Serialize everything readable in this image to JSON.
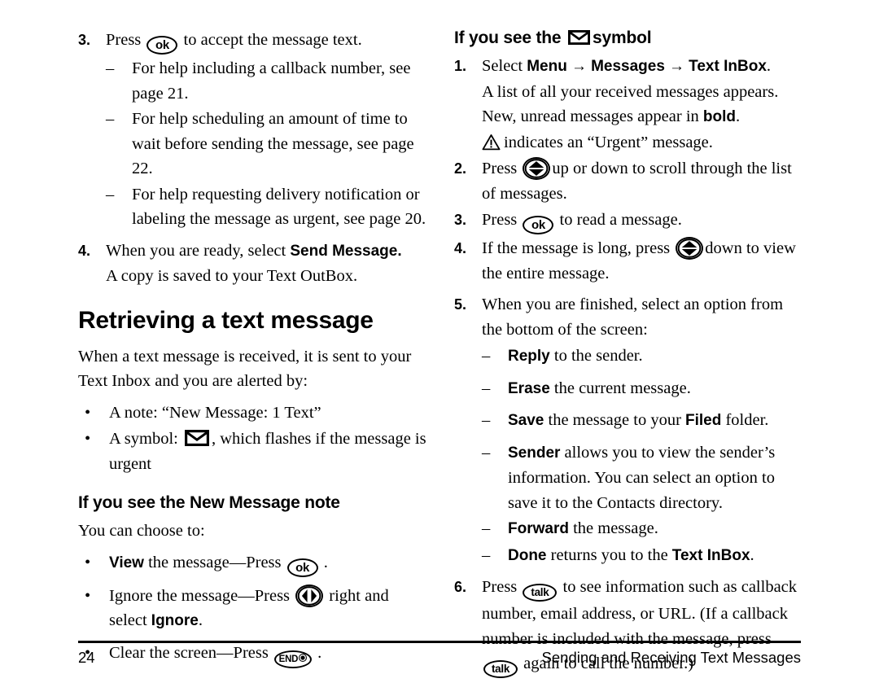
{
  "page": {
    "number": "24",
    "footer_title": "Sending and Receiving Text Messages"
  },
  "icons": {
    "ok_key": "ok",
    "talk_key": "talk",
    "end_key": "END",
    "nav_updown": "nav-updown-key-icon",
    "nav_leftright": "nav-leftright-key-icon",
    "envelope": "envelope-icon",
    "warning": "warning-triangle-icon",
    "arrow": "→"
  },
  "left_column": {
    "step3": {
      "num": "3.",
      "text_before_key": "Press",
      "text_after_key": "to accept the message text."
    },
    "step3_subitems": [
      {
        "dash": "–",
        "text": "For help including a callback number, see page 21."
      },
      {
        "dash": "–",
        "text": "For help scheduling an amount of time to wait before sending the message, see page 22."
      },
      {
        "dash": "–",
        "text": "For help requesting delivery notification or labeling the message as urgent, see page 20."
      }
    ],
    "step4": {
      "num": "4.",
      "text_before_bold": "When you are ready, select ",
      "bold": "Send Message.",
      "text_after_bold": "A copy is saved to your Text OutBox."
    },
    "heading": "Retrieving a text message",
    "intro": "When a text message is received, it is sent to your Text Inbox and you are alerted by:",
    "alert_bullets": [
      {
        "bullet": "•",
        "text": "A note: “New Message: 1 Text”"
      },
      {
        "bullet": "•",
        "text_before_icon": "A symbol:",
        "text_after_icon": ", which flashes if the message is urgent"
      }
    ],
    "subheading": "If you see the New Message note",
    "choose_intro": "You can choose to:",
    "choose_bullets": [
      {
        "bullet": "•",
        "bold": "View",
        "text_before_key": " the message—Press",
        "text_after_key": "."
      },
      {
        "bullet": "•",
        "text_before_key": "Ignore the message—Press",
        "text_after_key": " right and select ",
        "bold_tail": "Ignore",
        "tail_period": "."
      },
      {
        "bullet": "•",
        "text_before_key": "Clear the screen—Press",
        "text_after_key": "."
      }
    ]
  },
  "right_column": {
    "heading_before_icon": "If you see the",
    "heading_after_icon": "symbol",
    "step1": {
      "num": "1.",
      "select_label": "Select ",
      "menu": "Menu",
      "messages": "Messages",
      "text_inbox": "Text InBox",
      "period": ".",
      "line2": "A list of all your received messages appears.",
      "line3_before_bold": "New, unread messages appear in ",
      "line3_bold": "bold",
      "line3_after_bold": ".",
      "line4": "indicates an “Urgent” message."
    },
    "step2": {
      "num": "2.",
      "text_before_key": "Press",
      "text_after_key": "up or down to scroll through the list of messages."
    },
    "step3": {
      "num": "3.",
      "text_before_key": "Press",
      "text_after_key": "to read a message."
    },
    "step4": {
      "num": "4.",
      "text_before_key": "If the message is long, press",
      "text_after_key": "down to view the entire message."
    },
    "step5": {
      "num": "5.",
      "text": "When you are finished, select an option from the bottom of the screen:"
    },
    "step5_options": [
      {
        "dash": "–",
        "bold": "Reply",
        "text": " to the sender."
      },
      {
        "dash": "–",
        "bold": "Erase",
        "text": " the current message."
      },
      {
        "dash": "–",
        "bold": "Save",
        "text": " the message to your ",
        "bold2": "Filed",
        "text2": " folder."
      },
      {
        "dash": "–",
        "bold": "Sender",
        "text": " allows you to view the sender’s information. You can select an option to save it to the Contacts directory."
      },
      {
        "dash": "–",
        "bold": "Forward",
        "text": " the message."
      },
      {
        "dash": "–",
        "bold": "Done",
        "text": " returns you to the ",
        "bold2": "Text InBox",
        "text2": "."
      }
    ],
    "step6": {
      "num": "6.",
      "text_before_key": "Press",
      "text_mid": "to see information such as callback number, email address, or URL. (If a callback number is included with the message, press",
      "text_after_key2": "again to call the number.)"
    }
  }
}
